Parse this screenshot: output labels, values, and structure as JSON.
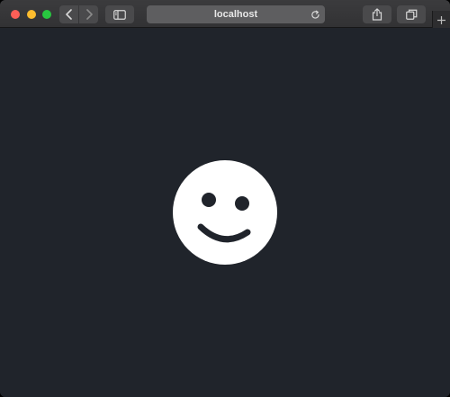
{
  "browser": {
    "url": "localhost",
    "traffic_colors": {
      "close": "#fe5f57",
      "minimize": "#febc2e",
      "zoom": "#28c840"
    },
    "icons": {
      "back": "chevron-left-icon",
      "forward": "chevron-right-icon",
      "sidebar": "sidebar-icon",
      "reload": "reload-icon",
      "share": "share-icon",
      "tabs": "tabs-overview-icon",
      "new_tab": "plus-icon"
    }
  },
  "page": {
    "background": "#20242b",
    "face": {
      "icon": "smiley-face-icon",
      "color": "#ffffff",
      "feature_color": "#20242b"
    }
  }
}
